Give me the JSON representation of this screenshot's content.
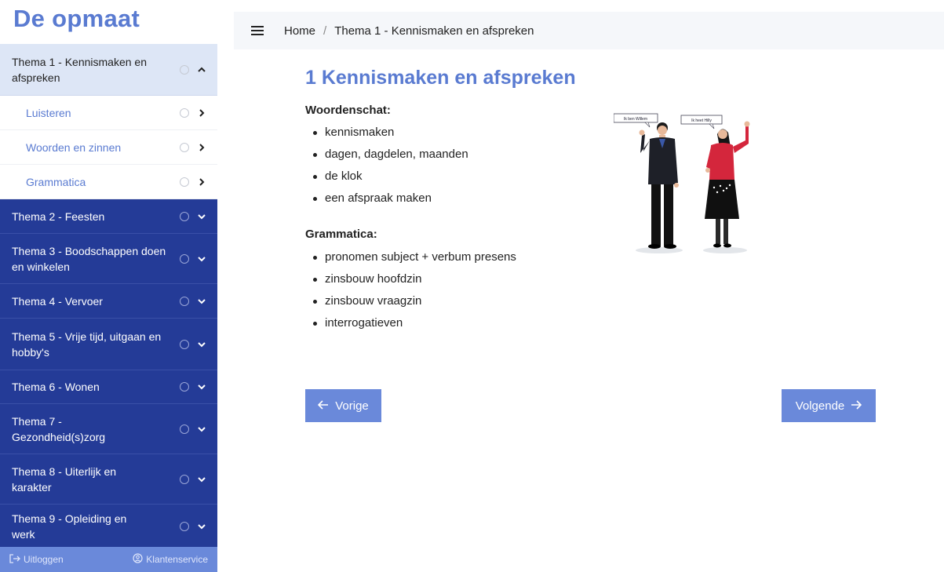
{
  "brand": "De opmaat",
  "sidebar": {
    "open_theme": "Thema 1 - Kennismaken en afspreken",
    "sub_items": [
      {
        "label": "Luisteren"
      },
      {
        "label": "Woorden en zinnen"
      },
      {
        "label": "Grammatica"
      }
    ],
    "themes": [
      {
        "label": "Thema 2 - Feesten"
      },
      {
        "label": "Thema 3 - Boodschappen doen en winkelen"
      },
      {
        "label": "Thema 4 - Vervoer"
      },
      {
        "label": "Thema 5 - Vrije tijd, uitgaan en hobby's"
      },
      {
        "label": "Thema 6 - Wonen"
      },
      {
        "label": "Thema 7 - Gezondheid(s)zorg"
      },
      {
        "label": "Thema 8 - Uiterlijk en karakter"
      },
      {
        "label": "Thema 9 - Opleiding en werk"
      }
    ],
    "footer": {
      "logout": "Uitloggen",
      "service": "Klantenservice"
    }
  },
  "breadcrumb": {
    "home": "Home",
    "separator": "/",
    "current": "Thema 1 - Kennismaken en afspreken"
  },
  "main": {
    "title": "1 Kennismaken en afspreken",
    "vocab_heading": "Woordenschat:",
    "vocab_items": [
      "kennismaken",
      "dagen, dagdelen, maanden",
      "de klok",
      "een afspraak maken"
    ],
    "grammar_heading": "Grammatica:",
    "grammar_items": [
      "pronomen subject + verbum presens",
      "zinsbouw hoofdzin",
      "zinsbouw vraagzin",
      "interrogatieven"
    ],
    "illustration_bubbles": [
      "Ik ben Willem",
      "Ik heet Hilly"
    ],
    "prev_label": "Vorige",
    "next_label": "Volgende"
  },
  "colors": {
    "accent": "#5a7bd1",
    "nav_dark": "#243b97",
    "button": "#6a89da",
    "open_theme_bg": "#dde6f6"
  },
  "icons": [
    "menu-icon",
    "circle-status-icon",
    "chevron-up-icon",
    "chevron-right-icon",
    "chevron-down-icon",
    "logout-icon",
    "support-icon",
    "arrow-left-icon",
    "arrow-right-icon"
  ]
}
